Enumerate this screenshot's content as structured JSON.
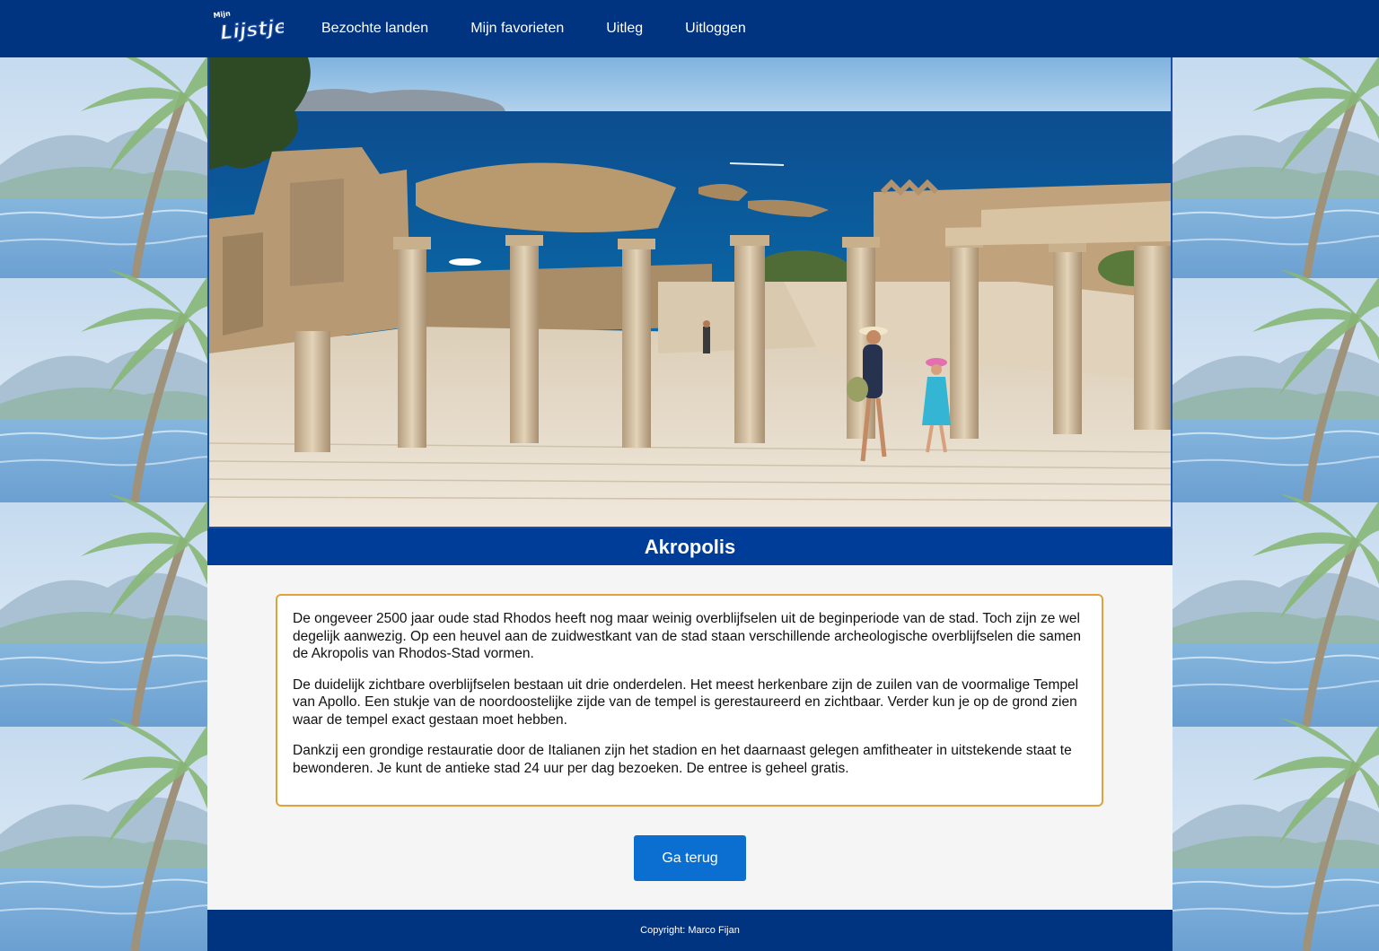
{
  "nav": {
    "logo_text": "Mijn Lijstje",
    "links": [
      "Bezochte landen",
      "Mijn favorieten",
      "Uitleg",
      "Uitloggen"
    ]
  },
  "page": {
    "title": "Akropolis",
    "paragraphs": [
      "De ongeveer 2500 jaar oude stad Rhodos heeft nog maar weinig overblijfselen uit de beginperiode van de stad. Toch zijn ze wel degelijk aanwezig. Op een heuvel aan de zuidwestkant van de stad staan verschillende archeologische overblijfselen die samen de Akropolis van Rhodos-Stad vormen.",
      "De duidelijk zichtbare overblijfselen bestaan uit drie onderdelen. Het meest herkenbare zijn de zuilen van de voormalige Tempel van Apollo. Een stukje van de noordoostelijke zijde van de tempel is gerestaureerd en zichtbaar. Verder kun je op de grond zien waar de tempel exact gestaan moet hebben.",
      "Dankzij een grondige restauratie door de Italianen zijn het stadion en het daarnaast gelegen amfitheater in uitstekende staat te bewonderen. Je kunt de antieke stad 24 uur per dag bezoeken. De entree is geheel gratis."
    ],
    "back_button": "Ga terug"
  },
  "footer": {
    "copyright": "Copyright: Marco Fijan"
  },
  "colors": {
    "nav_bg": "#003380",
    "title_bg": "#003d99",
    "button_bg": "#0a6fd1",
    "box_border": "#e0a23a"
  }
}
